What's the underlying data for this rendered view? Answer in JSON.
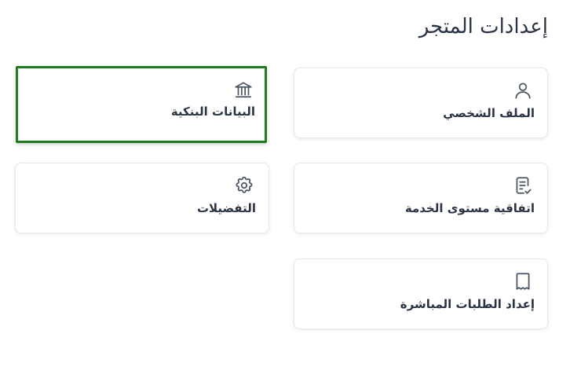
{
  "page": {
    "title": "إعدادات المتجر"
  },
  "cards": {
    "profile": {
      "label": "الملف الشخصي",
      "icon": "user-icon"
    },
    "bank": {
      "label": "البيانات البنكية",
      "icon": "bank-icon"
    },
    "sla": {
      "label": "اتفاقية مستوى الخدمة",
      "icon": "document-check-icon"
    },
    "preferences": {
      "label": "التفضيلات",
      "icon": "gear-icon"
    },
    "direct_orders": {
      "label": "إعداد الطلبات المباشرة",
      "icon": "receipt-icon"
    }
  },
  "colors": {
    "text": "#2b3445",
    "icon": "#4b5563",
    "highlight_border": "#1e7d1e",
    "card_border": "#e6e8ec"
  }
}
